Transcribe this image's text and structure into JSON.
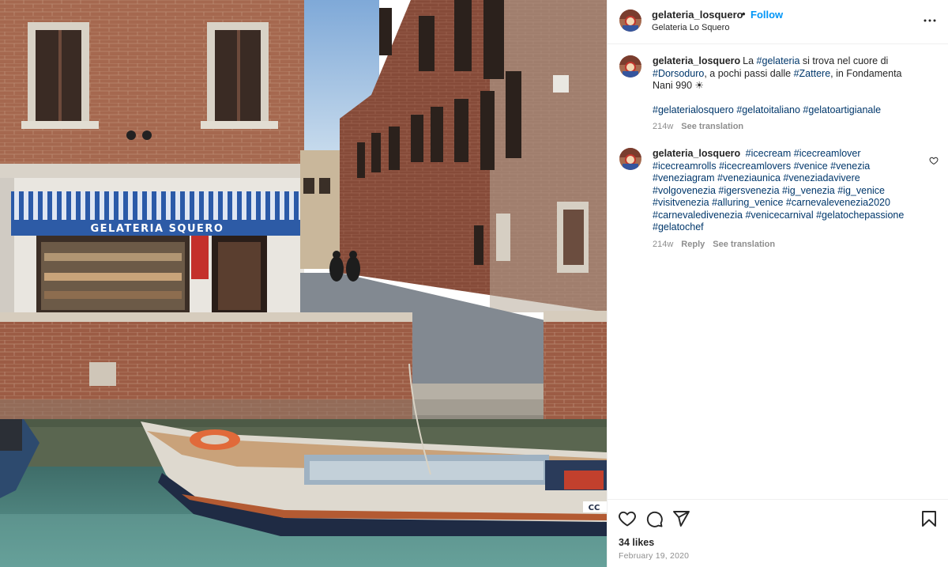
{
  "header": {
    "username": "gelateria_losquero",
    "separator": "•",
    "follow_label": "Follow",
    "location": "Gelateria Lo Squero",
    "more_icon": "more-horizontal-icon"
  },
  "photo": {
    "shop_sign": "GELATERIA SQUERO",
    "boat_label": "CC",
    "colors": {
      "awning_blue": "#2b5aa8",
      "brick": "#9a5a45",
      "water": "#4f8a86",
      "sky": "#a9c8e6"
    }
  },
  "caption": {
    "username": "gelateria_losquero",
    "segments": [
      {
        "text": "La ",
        "tag": false
      },
      {
        "text": "#gelateria",
        "tag": true
      },
      {
        "text": " si trova nel cuore di ",
        "tag": false
      },
      {
        "text": "#Dorsoduro",
        "tag": true
      },
      {
        "text": ", a pochi passi dalle ",
        "tag": false
      },
      {
        "text": "#Zattere",
        "tag": true
      },
      {
        "text": ", in Fondamenta Nani 990 ☀",
        "tag": false
      }
    ],
    "hashtags": "#gelaterialosquero #gelatoitaliano #gelatoartigianale",
    "time": "214w",
    "see_translation": "See translation"
  },
  "comment": {
    "username": "gelateria_losquero",
    "hashtags": [
      "#icecream",
      "#icecreamlover",
      "#icecreamrolls",
      "#icecreamlovers",
      "#venice",
      "#venezia",
      "#veneziagram",
      "#veneziaunica",
      "#veneziadavivere",
      "#volgovenezia",
      "#igersvenezia",
      "#ig_venezia",
      "#ig_venice",
      "#visitvenezia",
      "#alluring_venice",
      "#carnevalevenezia2020",
      "#carnevaledivenezia",
      "#venicecarnival",
      "#gelatochepassione",
      "#gelatochef"
    ],
    "time": "214w",
    "reply": "Reply",
    "see_translation": "See translation",
    "like_icon": "heart-icon"
  },
  "actions": {
    "like_icon": "heart-icon",
    "comment_icon": "comment-icon",
    "share_icon": "paper-plane-icon",
    "save_icon": "bookmark-icon",
    "likes": "34 likes",
    "date": "February 19, 2020"
  }
}
